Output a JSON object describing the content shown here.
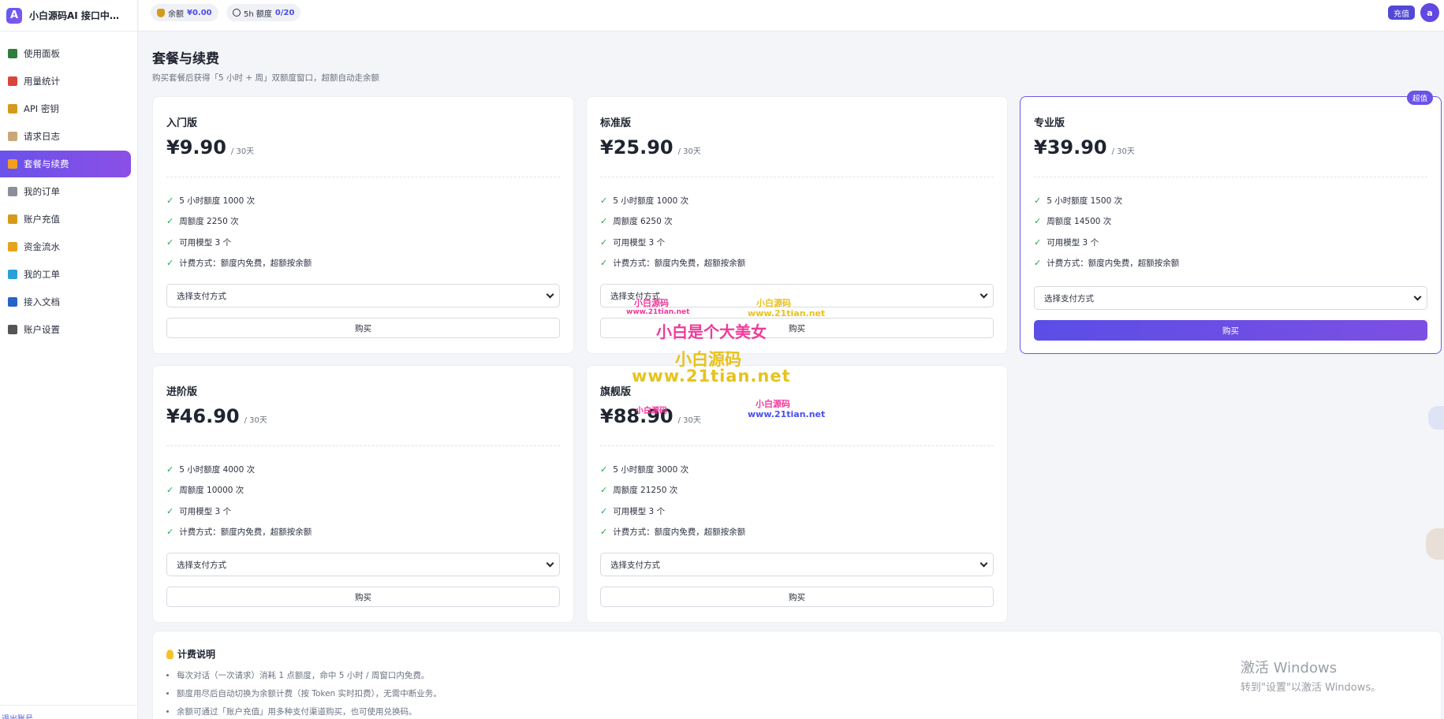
{
  "brand": {
    "logo_letter": "A",
    "name": "小白源码AI 接口中转..."
  },
  "sidebar": {
    "items": [
      {
        "label": "使用面板",
        "icon": "chart-icon",
        "color": "#2f7d3a"
      },
      {
        "label": "用量统计",
        "icon": "trend-icon",
        "color": "#d9443b"
      },
      {
        "label": "API 密钥",
        "icon": "key-icon",
        "color": "#d59a1b"
      },
      {
        "label": "请求日志",
        "icon": "scroll-icon",
        "color": "#c8a87a"
      },
      {
        "label": "套餐与续费",
        "icon": "gift-icon",
        "color": "#f0a020"
      },
      {
        "label": "我的订单",
        "icon": "receipt-icon",
        "color": "#8a8f99"
      },
      {
        "label": "账户充值",
        "icon": "moneybag-icon",
        "color": "#d59a1b"
      },
      {
        "label": "资金流水",
        "icon": "ledger-icon",
        "color": "#e5a21c"
      },
      {
        "label": "我的工单",
        "icon": "ticket-icon",
        "color": "#2a9fd8"
      },
      {
        "label": "接入文档",
        "icon": "book-icon",
        "color": "#2563c8"
      },
      {
        "label": "账户设置",
        "icon": "gear-icon",
        "color": "#555"
      }
    ],
    "logout_label": "退出账号"
  },
  "topbar": {
    "balance_label": "余额",
    "balance_value": "¥0.00",
    "quota_label": "5h 额度",
    "quota_value": "0/20",
    "recharge_label": "充值",
    "avatar_letter": "a"
  },
  "page": {
    "title": "套餐与续费",
    "subtitle": "购买套餐后获得「5 小时 + 周」双额度窗口，超额自动走余额"
  },
  "plans": [
    {
      "name": "入门版",
      "price": "¥9.90",
      "period": "/ 30天",
      "features": [
        "5 小时额度 1000 次",
        "周额度 2250 次",
        "可用模型 3 个",
        "计费方式：额度内免费，超额按余额"
      ],
      "select_label": "选择支付方式",
      "buy_label": "购买"
    },
    {
      "name": "标准版",
      "price": "¥25.90",
      "period": "/ 30天",
      "features": [
        "5 小时额度 1000 次",
        "周额度 6250 次",
        "可用模型 3 个",
        "计费方式：额度内免费，超额按余额"
      ],
      "select_label": "选择支付方式",
      "buy_label": "购买"
    },
    {
      "name": "专业版",
      "price": "¥39.90",
      "period": "/ 30天",
      "badge": "超值",
      "features": [
        "5 小时额度 1500 次",
        "周额度 14500 次",
        "可用模型 3 个",
        "计费方式：额度内免费，超额按余额"
      ],
      "select_label": "选择支付方式",
      "buy_label": "购买"
    },
    {
      "name": "进阶版",
      "price": "¥46.90",
      "period": "/ 30天",
      "features": [
        "5 小时额度 4000 次",
        "周额度 10000 次",
        "可用模型 3 个",
        "计费方式：额度内免费，超额按余额"
      ],
      "select_label": "选择支付方式",
      "buy_label": "购买"
    },
    {
      "name": "旗舰版",
      "price": "¥88.90",
      "period": "/ 30天",
      "features": [
        "5 小时额度 3000 次",
        "周额度 21250 次",
        "可用模型 3 个",
        "计费方式：额度内免费，超额按余额"
      ],
      "select_label": "选择支付方式",
      "buy_label": "购买"
    }
  ],
  "billing": {
    "title": "计费说明",
    "notes": [
      "每次对话（一次请求）消耗 1 点额度，命中 5 小时 / 周窗口内免费。",
      "额度用尽后自动切换为余额计费（按 Token 实时扣费），无需中断业务。",
      "余额可通过「账户充值」用多种支付渠道购买，也可使用兑换码。"
    ]
  },
  "watermarks": {
    "small_name": "小白源码",
    "small_url": "www.21tian.net",
    "big_phrase": "小白是个大美女",
    "big_name": "小白源码",
    "big_url": "www.21tian.net"
  },
  "windows_activation": {
    "line1": "激活 Windows",
    "line2": "转到\"设置\"以激活 Windows。"
  }
}
